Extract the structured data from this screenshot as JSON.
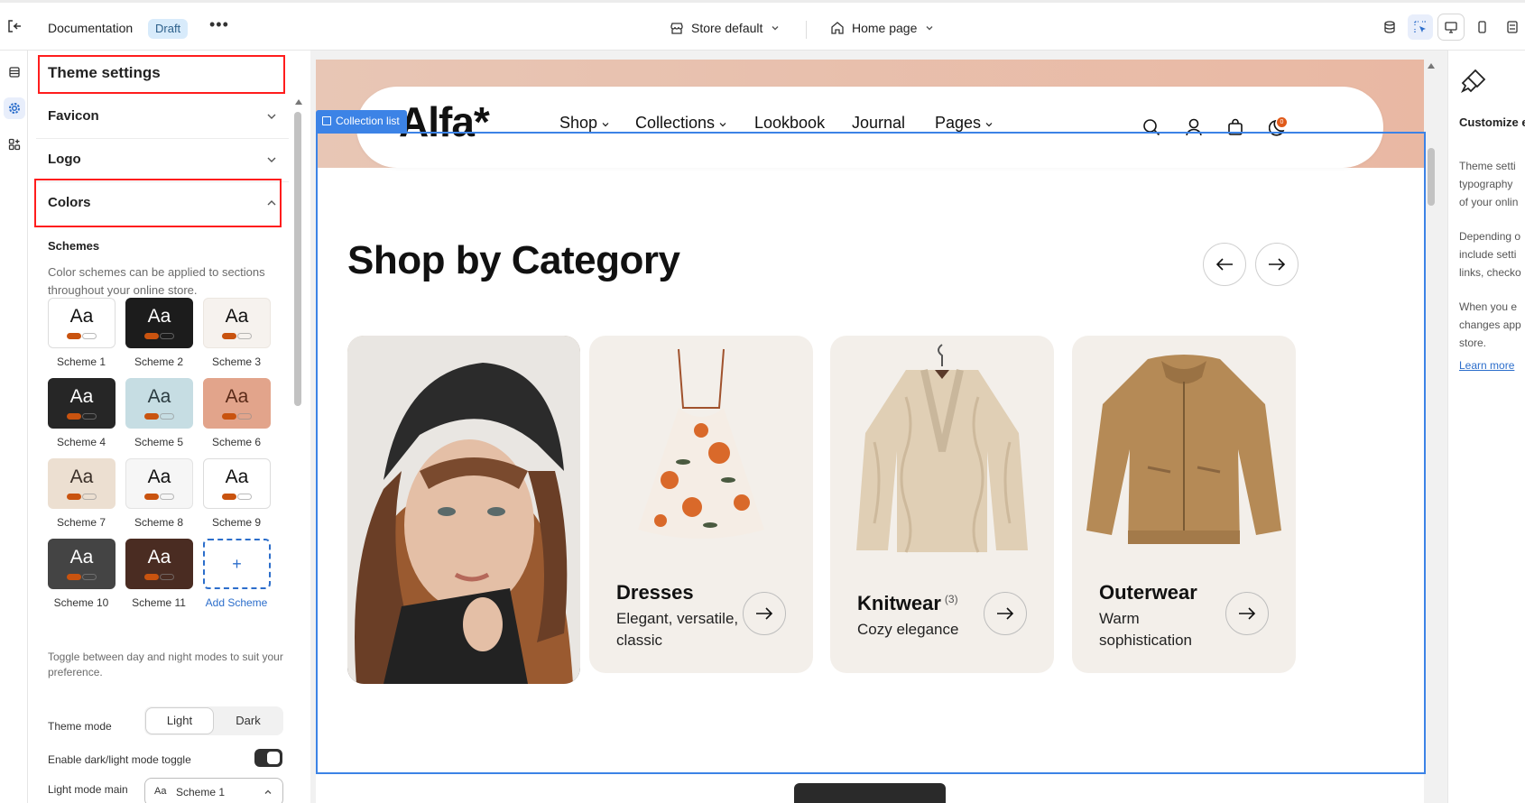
{
  "topbar": {
    "document_label": "Documentation",
    "status_badge": "Draft",
    "more_label": "•••",
    "store_label": "Store default",
    "page_label": "Home page"
  },
  "panel": {
    "title": "Theme settings",
    "sections": {
      "favicon": "Favicon",
      "logo": "Logo",
      "colors": "Colors"
    },
    "schemes_heading": "Schemes",
    "schemes_description": "Color schemes can be applied to sections throughout your online store.",
    "schemes": [
      {
        "label": "Scheme 1",
        "bg": "#ffffff",
        "fg": "#111111",
        "border": "#dcdcdc"
      },
      {
        "label": "Scheme 2",
        "bg": "#1c1c1c",
        "fg": "#ffffff",
        "border": "#1c1c1c"
      },
      {
        "label": "Scheme 3",
        "bg": "#f6f2ee",
        "fg": "#111111",
        "border": "#ece6e0"
      },
      {
        "label": "Scheme 4",
        "bg": "#262626",
        "fg": "#ffffff",
        "border": "#262626"
      },
      {
        "label": "Scheme 5",
        "bg": "#c6dde3",
        "fg": "#2b3b40",
        "border": "#c6dde3"
      },
      {
        "label": "Scheme 6",
        "bg": "#e2a48b",
        "fg": "#5a2a18",
        "border": "#e2a48b"
      },
      {
        "label": "Scheme 7",
        "bg": "#ecdfd1",
        "fg": "#3a2f28",
        "border": "#ecdfd1"
      },
      {
        "label": "Scheme 8",
        "bg": "#f6f6f6",
        "fg": "#111111",
        "border": "#e3e3e3"
      },
      {
        "label": "Scheme 9",
        "bg": "#ffffff",
        "fg": "#111111",
        "border": "#dcdcdc"
      },
      {
        "label": "Scheme 10",
        "bg": "#444444",
        "fg": "#ffffff",
        "border": "#444444"
      },
      {
        "label": "Scheme 11",
        "bg": "#4a2c22",
        "fg": "#ffffff",
        "border": "#4a2c22"
      }
    ],
    "add_scheme_icon": "+",
    "add_scheme_label": "Add Scheme",
    "mode_description": "Toggle between day and night modes to suit your preference.",
    "theme_mode_label": "Theme mode",
    "theme_mode_options": [
      "Light",
      "Dark"
    ],
    "theme_mode_selected": "Light",
    "toggle_label": "Enable dark/light mode toggle",
    "toggle_on": true,
    "light_mode_label": "Light mode main",
    "light_mode_aa": "Aa",
    "light_mode_value": "Scheme 1"
  },
  "store": {
    "logo": "Alfa*",
    "nav": [
      "Shop",
      "Collections",
      "Lookbook",
      "Journal",
      "Pages"
    ],
    "cart_count": "0",
    "selection_tag": "Collection list",
    "section_title": "Shop by Category",
    "cards": [
      {
        "name": "",
        "count": "",
        "description": "",
        "kind": "photo"
      },
      {
        "name": "Dresses",
        "count": "",
        "description": "Elegant, versatile, classic",
        "kind": "dress"
      },
      {
        "name": "Knitwear",
        "count": "(3)",
        "description": "Cozy elegance",
        "kind": "knit"
      },
      {
        "name": "Outerwear",
        "count": "",
        "description": "Warm sophistication",
        "kind": "jacket"
      }
    ]
  },
  "right_panel": {
    "title": "Customize entire onlin",
    "p1": [
      "Theme setti",
      "typography",
      "of your onlin"
    ],
    "p2": [
      "Depending o",
      "include setti",
      "links, checko"
    ],
    "p3": [
      "When you e",
      "changes app",
      "store."
    ],
    "link": "Learn more"
  },
  "colors": {
    "accent": "#3c83e6",
    "highlight_red": "#ff1d1d",
    "brand_orange": "#c9530f"
  }
}
